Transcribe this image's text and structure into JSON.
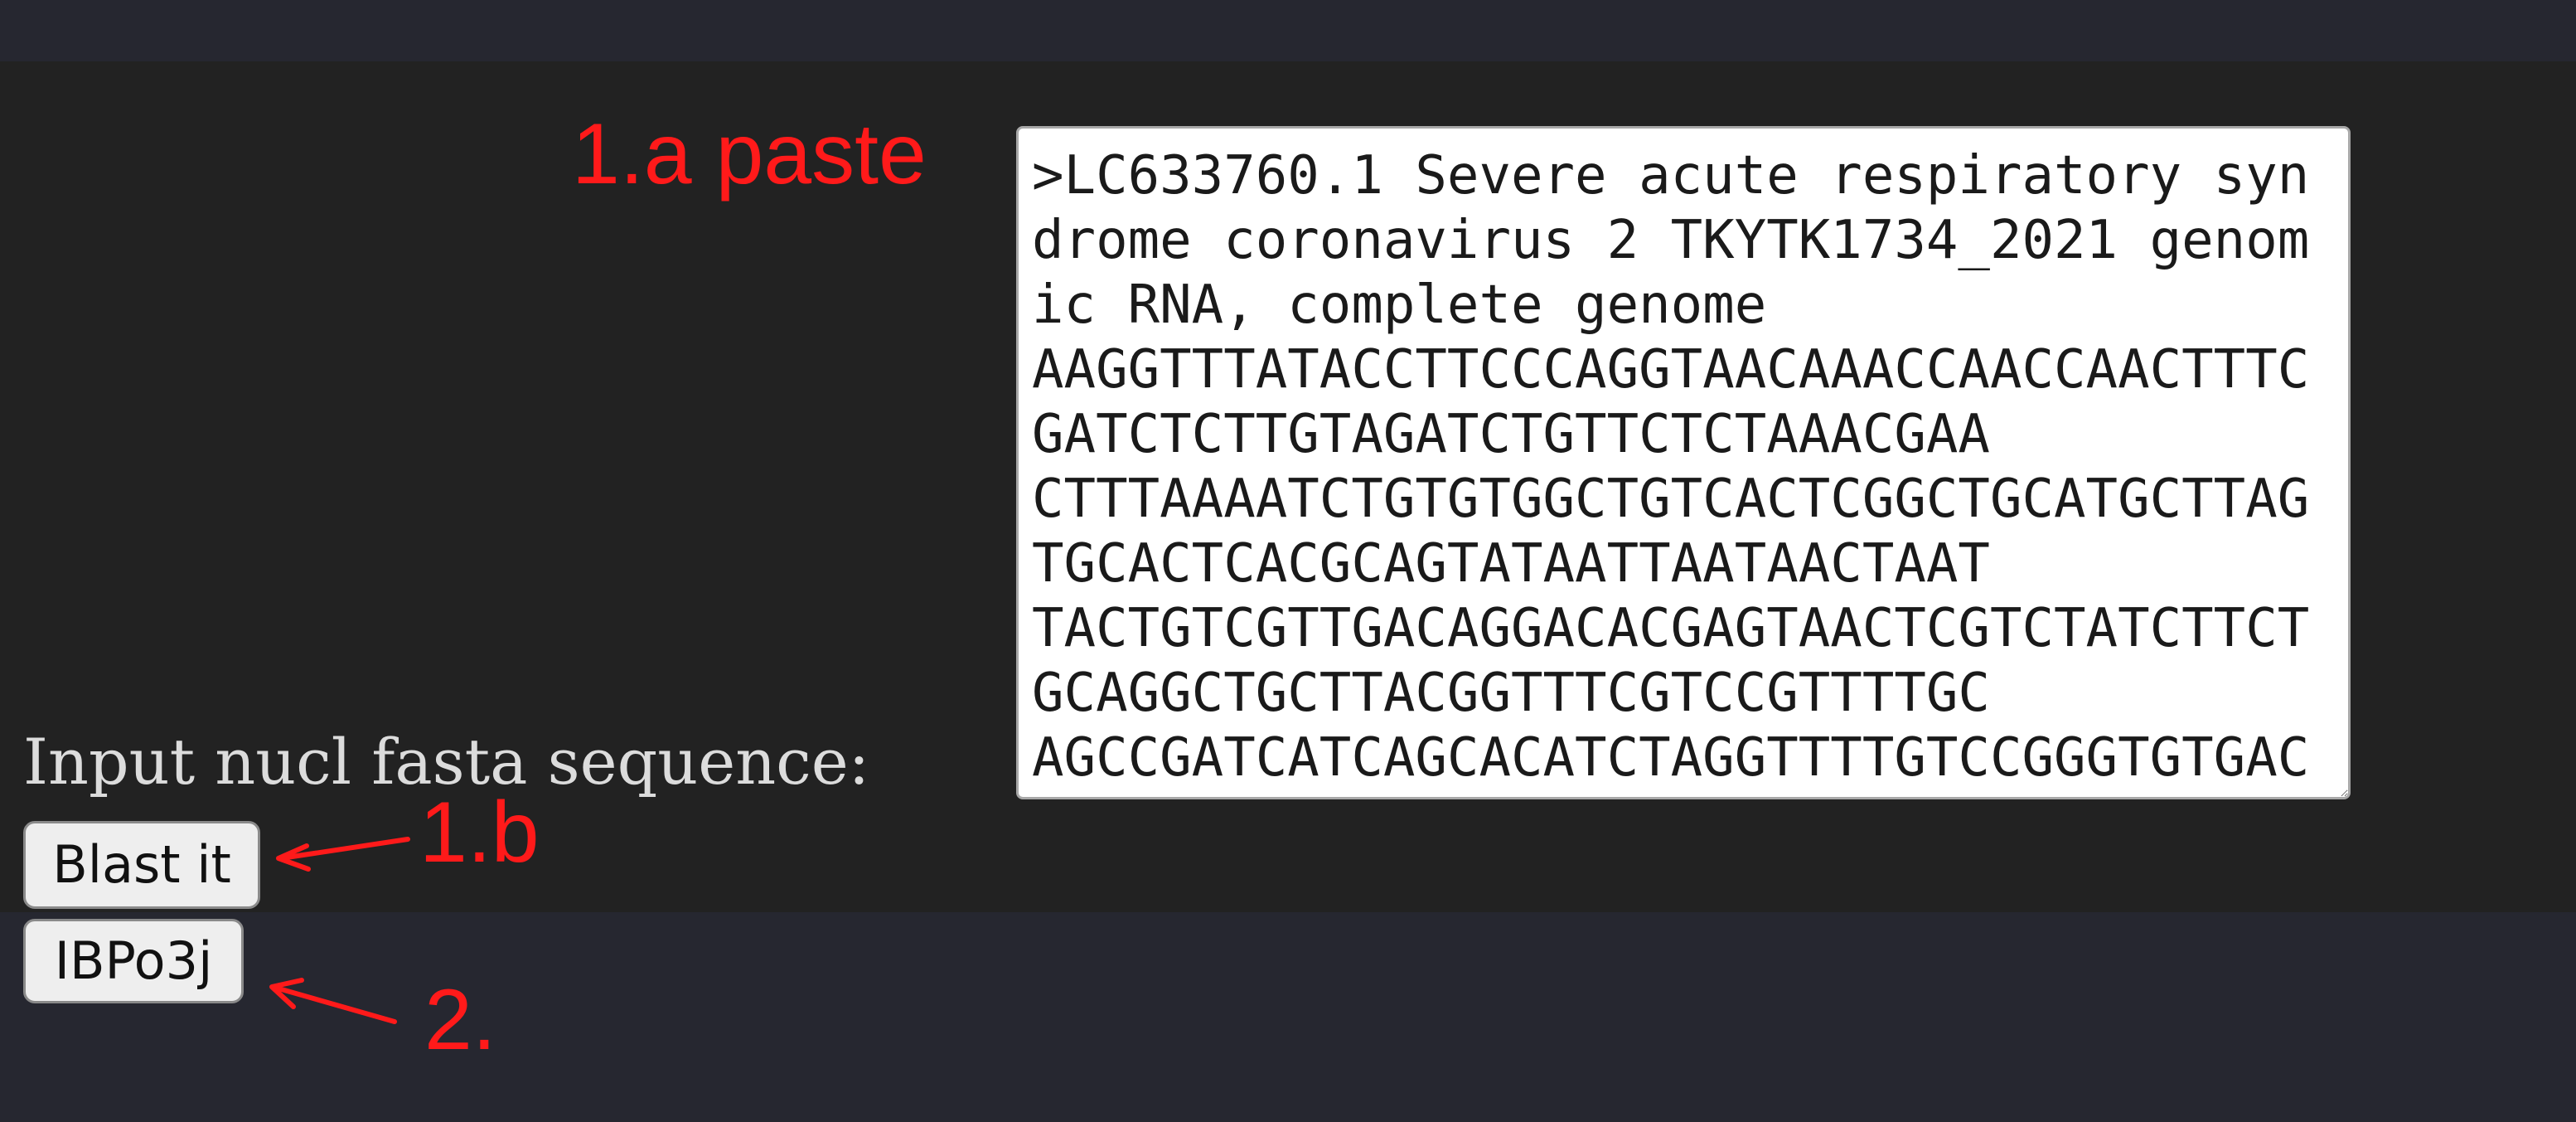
{
  "form": {
    "sequence_label": "Input nucl fasta sequence:",
    "sequence_value": ">LC633760.1 Severe acute respiratory syndrome coronavirus 2 TKYTK1734_2021 genomic RNA, complete genome\nAAGGTTTATACCTTCCCAGGTAACAAACCAACCAACTTTC\nGATCTCTTGTAGATCTGTTCTCTAAACGAA\nCTTTAAAATCTGTGTGGCTGTCACTCGGCTGCATGCTTAG\nTGCACTCACGCAGTATAATTAATAACTAAT\nTACTGTCGTTGACAGGACACGAGTAACTCGTCTATCTTCT\nGCAGGCTGCTTACGGTTTCGTCCGTTTTGC\nAGCCGATCATCAGCACATCTAGGTTTTGTCCGGGTGTGAC",
    "submit_label": "Blast it"
  },
  "job": {
    "button_label": "IBPo3j"
  },
  "annotations": {
    "paste": "1.a paste",
    "submit": "1.b",
    "job": "2.",
    "color": "#ff1a1a"
  },
  "theme": {
    "page_background": "#262730",
    "panel_background": "#222222"
  }
}
